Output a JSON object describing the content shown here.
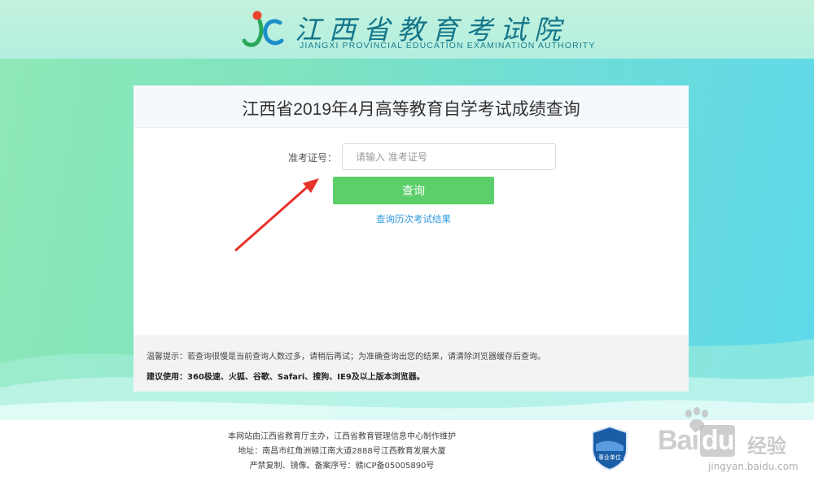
{
  "header": {
    "logo_cn": "江西省教育考试院",
    "logo_en": "JIANGXI PROVINCIAL EDUCATION EXAMINATION AUTHORITY"
  },
  "card": {
    "title": "江西省2019年4月高等教育自学考试成绩查询",
    "field_label": "准考证号：",
    "field_placeholder": "请输入 准考证号",
    "field_value": "",
    "query_button": "查询",
    "history_link": "查询历次考试结果",
    "tip": "温馨提示：若查询很慢是当前查询人数过多，请稍后再试；为准确查询出您的结果，请清除浏览器缓存后查询。",
    "recommend": "建议使用：360极速、火狐、谷歌、Safari、搜狗、IE9及以上版本浏览器。"
  },
  "footer": {
    "line1": "本网站由江西省教育厅主办，江西省教育管理信息中心制作维护",
    "line2": "地址：南昌市红角洲赣江南大道2888号江西教育发展大厦",
    "line3": "严禁复制、镜像。备案序号：赣ICP备05005890号",
    "badge": "事业单位"
  },
  "watermark": {
    "brand_a": "Bai",
    "brand_b": "du",
    "brand_cn": "经验",
    "url": "jingyan.baidu.com"
  },
  "colors": {
    "accent_green": "#5ccf6a",
    "link_blue": "#2f9ae0",
    "logo_teal": "#14768a",
    "annotation_red": "#e8322c"
  },
  "icons": {
    "logo": "jc-logo-icon",
    "arrow": "red-arrow-icon",
    "badge": "shield-badge-icon",
    "watermark": "baidu-paw-icon"
  }
}
